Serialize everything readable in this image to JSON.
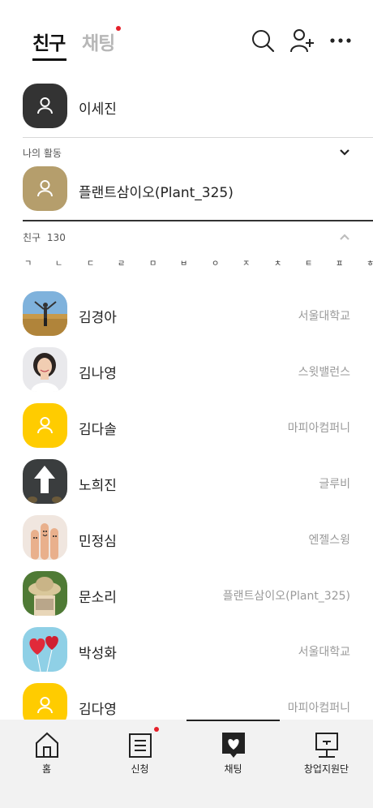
{
  "header": {
    "tabs": [
      {
        "label": "친구",
        "active": true
      },
      {
        "label": "채팅",
        "active": false,
        "has_dot": true
      }
    ],
    "icons": [
      "search-icon",
      "add-friend-icon",
      "more-icon"
    ]
  },
  "my_profile": {
    "name": "이세진",
    "avatar_icon": "person-icon"
  },
  "activity": {
    "label": "나의 활동",
    "toggle_icon": "chevron-down-icon",
    "item": {
      "name": "플랜트삼이오(Plant_325)",
      "avatar_icon": "person-icon"
    }
  },
  "friends": {
    "label": "친구",
    "count": "130",
    "toggle_icon": "chevron-up-icon",
    "index": [
      "ㄱ",
      "ㄴ",
      "ㄷ",
      "ㄹ",
      "ㅁ",
      "ㅂ",
      "ㅇ",
      "ㅈ",
      "ㅊ",
      "ㅌ",
      "ㅍ",
      "ㅎ"
    ],
    "list": [
      {
        "name": "김경아",
        "affiliation": "서울대학교",
        "avatar": "photo-field"
      },
      {
        "name": "김나영",
        "affiliation": "스윗밸런스",
        "avatar": "photo-woman"
      },
      {
        "name": "김다솔",
        "affiliation": "마피아컴퍼니",
        "avatar": "person-icon-yellow"
      },
      {
        "name": "노희진",
        "affiliation": "글루비",
        "avatar": "photo-arrow"
      },
      {
        "name": "민정심",
        "affiliation": "엔젤스윙",
        "avatar": "photo-fingers"
      },
      {
        "name": "문소리",
        "affiliation": "플랜트삼이오(Plant_325)",
        "avatar": "photo-hat"
      },
      {
        "name": "박성화",
        "affiliation": "서울대학교",
        "avatar": "photo-balloons"
      },
      {
        "name": "김다영",
        "affiliation": "마피아컴퍼니",
        "avatar": "person-icon-yellow"
      }
    ]
  },
  "bottom_nav": {
    "items": [
      {
        "label": "홈",
        "icon": "home-icon"
      },
      {
        "label": "신청",
        "icon": "apply-icon",
        "has_dot": true
      },
      {
        "label": "채팅",
        "icon": "chat-heart-icon",
        "active": true
      },
      {
        "label": "창업지원단",
        "icon": "board-icon"
      }
    ]
  },
  "colors": {
    "accent_dot": "#e5202a",
    "dark_avatar": "#333333",
    "gold_avatar": "#b59e6c",
    "yellow_avatar": "#ffcc00",
    "muted_text": "#9a9a9a"
  }
}
